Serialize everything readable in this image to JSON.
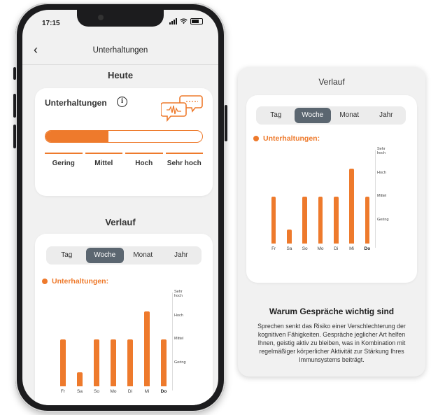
{
  "phone": {
    "status_time": "17:15",
    "nav_title": "Unterhaltungen",
    "section_today": "Heute",
    "card": {
      "title": "Unterhaltungen",
      "progress_fraction": 0.4,
      "levels": [
        "Gering",
        "Mittel",
        "Hoch",
        "Sehr hoch"
      ]
    },
    "section_history": "Verlauf"
  },
  "panel": {
    "title": "Verlauf",
    "why_title": "Warum Gespräche wichtig sind",
    "why_text": "Sprechen senkt das Risiko einer Verschlechterung der kognitiven Fähigkeiten. Gespräche jeglicher Art helfen Ihnen, geistig aktiv zu bleiben, was in Kombination mit regelmäßiger körperlicher Aktivität zur Stärkung Ihres Immunsystems beiträgt."
  },
  "tabs": [
    "Tag",
    "Woche",
    "Monat",
    "Jahr"
  ],
  "active_tab": "Woche",
  "legend_label": "Unterhaltungen:",
  "colors": {
    "accent": "#ee7a2c",
    "active_tab": "#5b6670",
    "background": "#f1f1f1"
  },
  "icons": [
    "back-chevron-icon",
    "info-icon",
    "speech-bubbles-icon",
    "signal-icon",
    "wifi-icon",
    "battery-icon"
  ],
  "chart_data": {
    "type": "bar",
    "categories": [
      "Fr",
      "Sa",
      "So",
      "Mo",
      "Di",
      "Mi",
      "Do"
    ],
    "values": [
      2,
      0.6,
      2,
      2,
      2,
      3.2,
      2
    ],
    "y_tick_labels": [
      "Gering",
      "Mittel",
      "Hoch",
      "Sehr hoch"
    ],
    "ylim": [
      0,
      4
    ],
    "highlighted_category": "Do",
    "grid": false
  }
}
